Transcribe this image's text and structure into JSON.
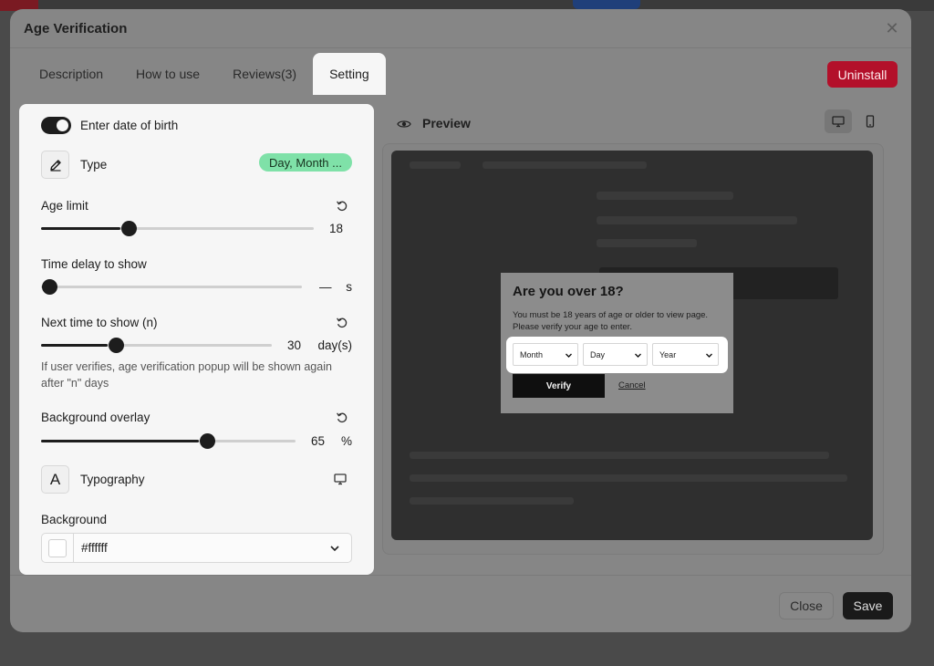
{
  "modal": {
    "title": "Age Verification",
    "close_icon": "close-icon"
  },
  "tabs": [
    {
      "label": "Description",
      "active": false
    },
    {
      "label": "How to use",
      "active": false
    },
    {
      "label": "Reviews(3)",
      "active": false
    },
    {
      "label": "Setting",
      "active": true
    }
  ],
  "uninstall_label": "Uninstall",
  "settings": {
    "dob": {
      "label": "Enter date of birth",
      "enabled": true
    },
    "type": {
      "label": "Type",
      "value": "Day, Month ...",
      "icon": "pencil-icon"
    },
    "age_limit": {
      "label": "Age limit",
      "value": "18",
      "fraction": 0.29
    },
    "time_delay": {
      "label": "Time delay to show",
      "value": "—",
      "unit": "s",
      "fraction": 0.0
    },
    "next_time": {
      "label": "Next time to show (n)",
      "value": "30",
      "unit": "day(s)",
      "fraction": 0.29,
      "help": "If user verifies, age verification popup will be shown again after \"n\" days"
    },
    "overlay": {
      "label": "Background overlay",
      "value": "65",
      "unit": "%",
      "fraction": 0.62
    },
    "typography": {
      "label": "Typography",
      "icon_glyph": "A"
    },
    "background": {
      "label": "Background",
      "value": "#ffffff",
      "swatch_color": "#ffffff"
    }
  },
  "preview": {
    "label": "Preview",
    "popup": {
      "title": "Are you over 18?",
      "description": "You must be 18 years of age or older to view page. Please verify your age to enter.",
      "month": "Month",
      "day": "Day",
      "year": "Year",
      "verify": "Verify",
      "cancel": "Cancel"
    }
  },
  "footer": {
    "close": "Close",
    "save": "Save"
  },
  "colors": {
    "accent_red": "#b3102a",
    "toggle_on": "#1d1d1d",
    "pill_green": "#7fe1a8"
  }
}
